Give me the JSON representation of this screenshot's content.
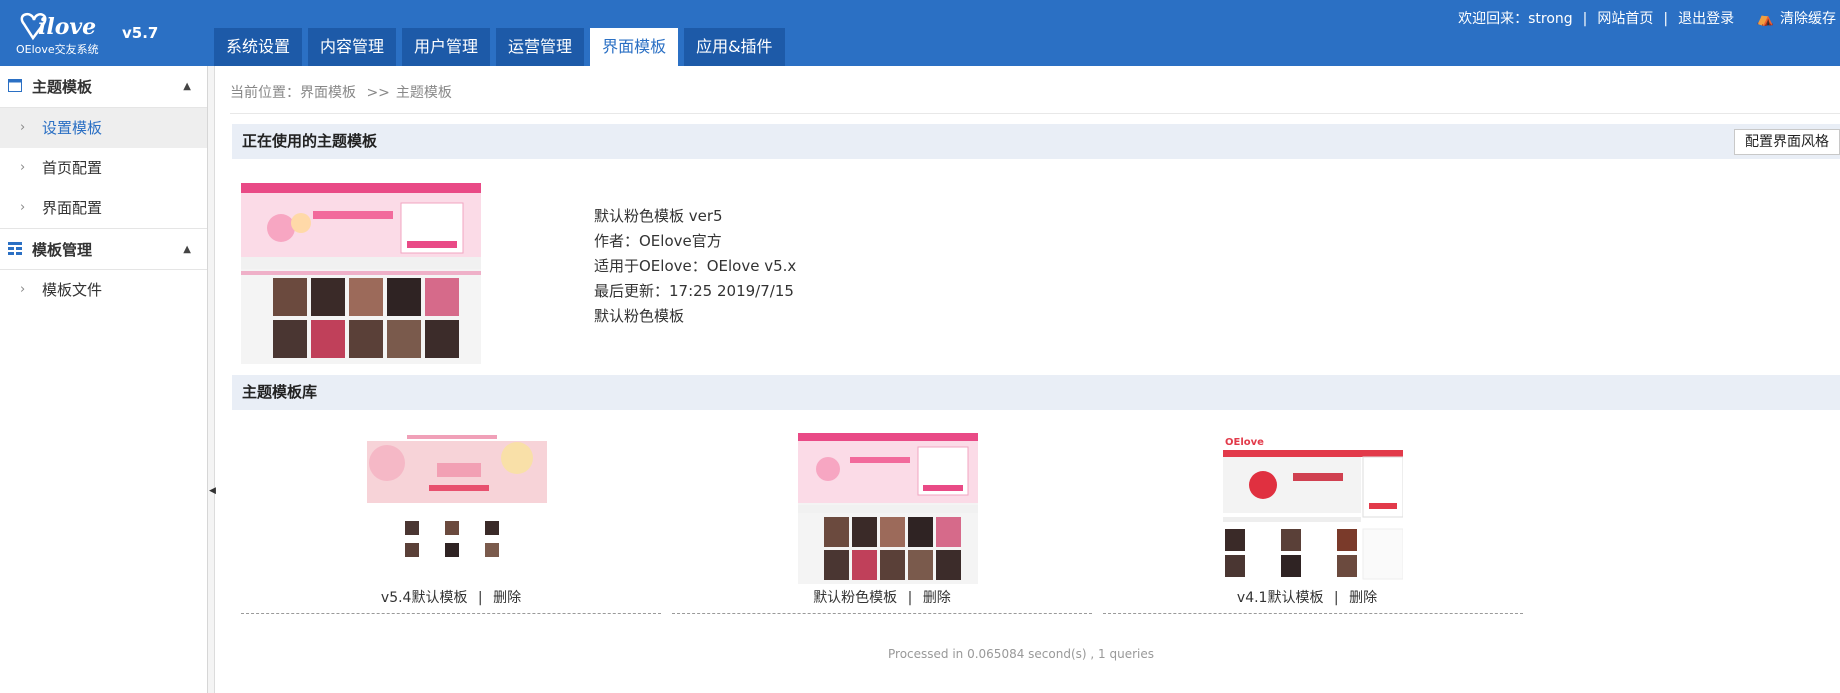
{
  "app": {
    "logo_text": "OElove交友系统",
    "version": "v5.7"
  },
  "nav": {
    "tabs": [
      {
        "label": "系统设置"
      },
      {
        "label": "内容管理"
      },
      {
        "label": "用户管理"
      },
      {
        "label": "运营管理"
      },
      {
        "label": "界面模板",
        "active": true
      },
      {
        "label": "应用&插件"
      }
    ]
  },
  "toplinks": {
    "welcome": "欢迎回来：strong",
    "site_home": "网站首页",
    "logout": "退出登录",
    "clear_cache": "清除缓存"
  },
  "sidebar": {
    "groups": [
      {
        "title": "主题模板",
        "icon": "window-icon",
        "items": [
          {
            "label": "设置模板",
            "active": true
          },
          {
            "label": "首页配置"
          },
          {
            "label": "界面配置"
          }
        ]
      },
      {
        "title": "模板管理",
        "icon": "grid-icon",
        "items": [
          {
            "label": "模板文件"
          }
        ]
      }
    ]
  },
  "breadcrumb": {
    "prefix": "当前位置：",
    "part1": "界面模板",
    "sep": ">>",
    "part2": "主题模板"
  },
  "current": {
    "section_title": "正在使用的主题模板",
    "config_button": "配置界面风格",
    "name": "默认粉色模板 ver5",
    "author": "作者：OElove官方",
    "compat": "适用于OElove：OElove v5.x",
    "updated": "最后更新：17:25 2019/7/15",
    "desc": "默认粉色模板"
  },
  "library": {
    "section_title": "主题模板库",
    "delete_label": "删除",
    "items": [
      {
        "name": "v5.4默认模板"
      },
      {
        "name": "默认粉色模板"
      },
      {
        "name": "v4.1默认模板"
      }
    ]
  },
  "footer": {
    "text": "Processed in 0.065084 second(s) , 1 queries"
  },
  "colors": {
    "brand_blue": "#2b70c4",
    "nav_tab": "#1d5aa8",
    "section_bg": "#e9eef6",
    "pink": "#f04f8a"
  }
}
